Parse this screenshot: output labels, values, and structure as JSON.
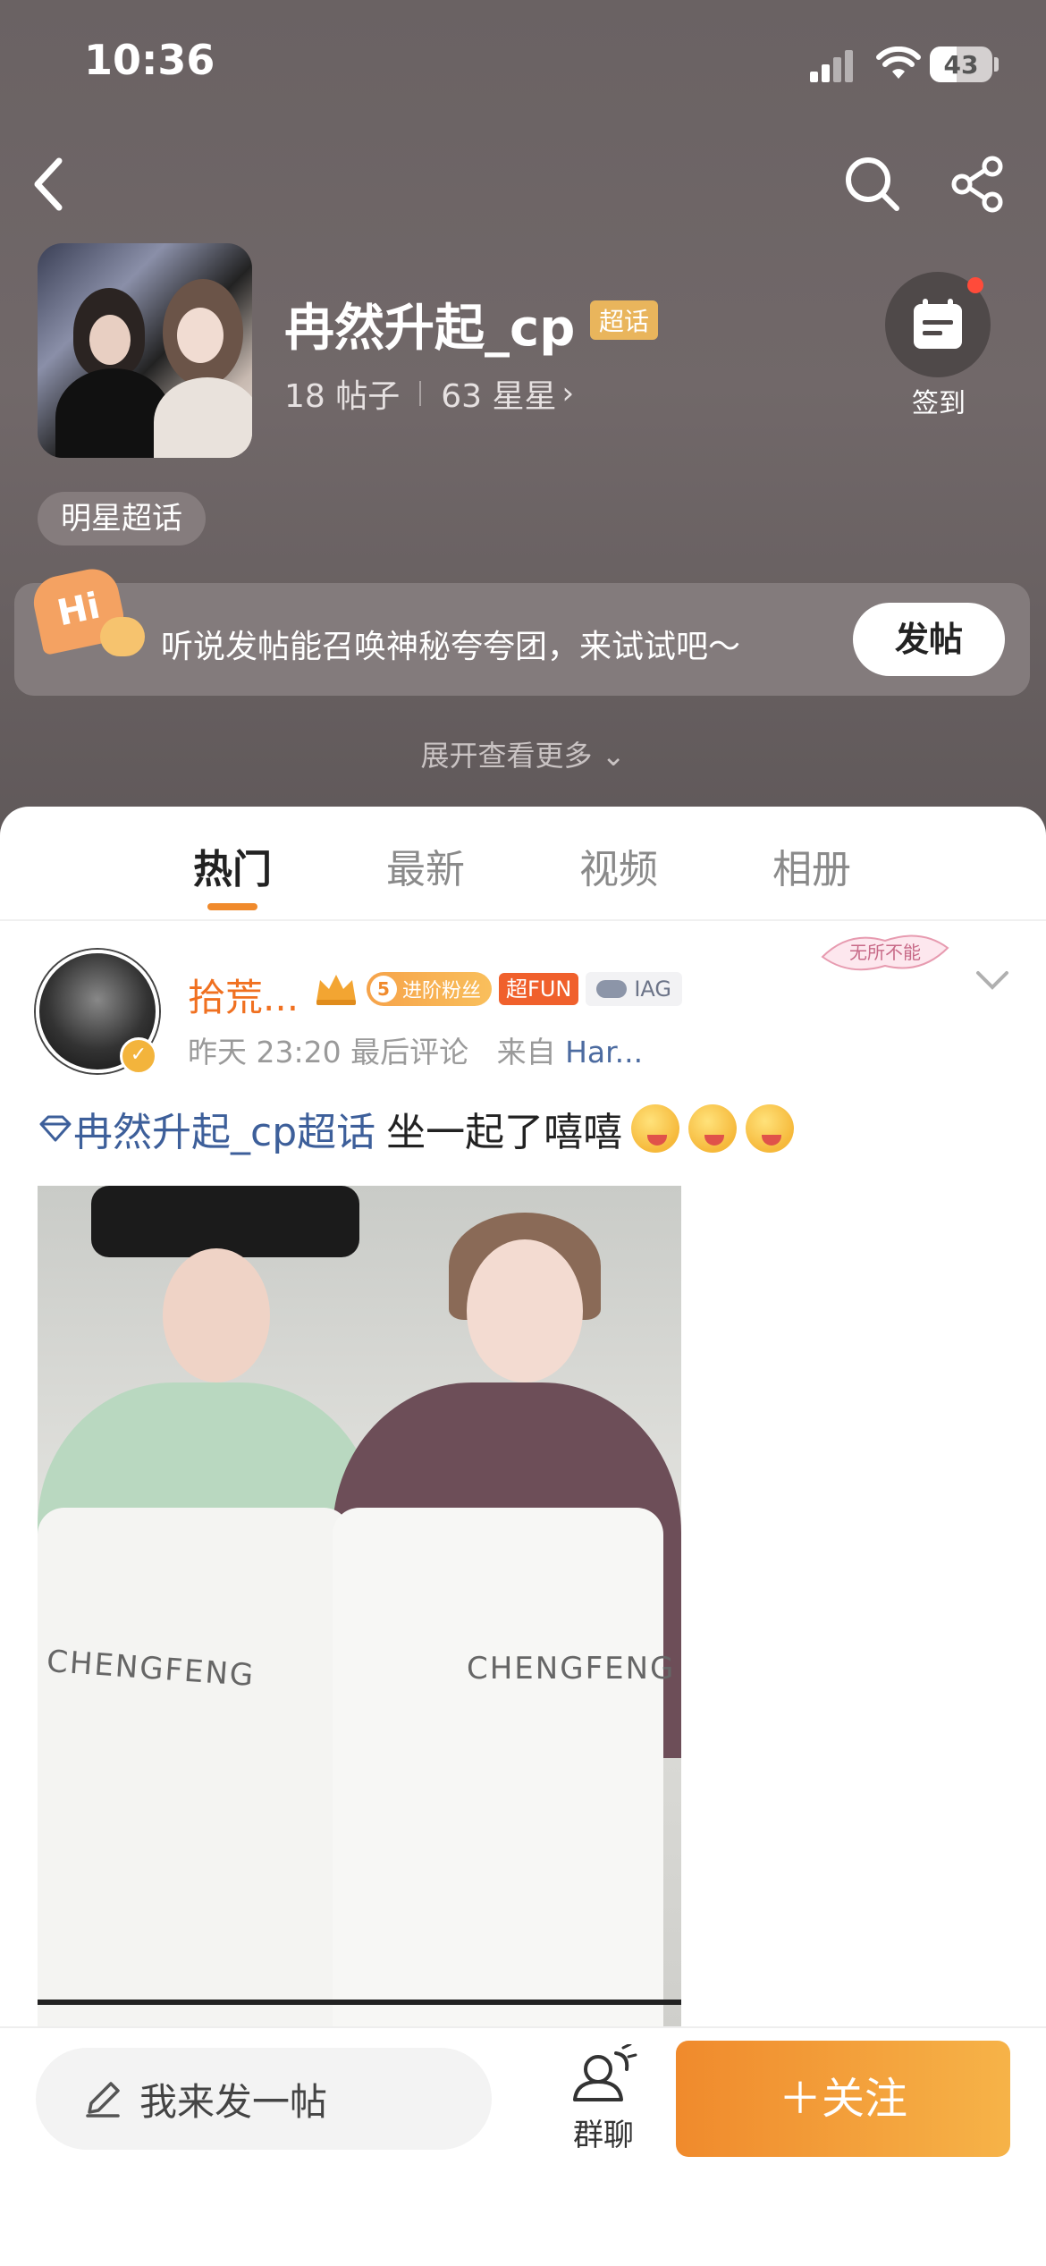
{
  "status_bar": {
    "time": "10:36",
    "battery": "43"
  },
  "nav": {
    "back_icon": "chevron-left-icon",
    "search_icon": "search-icon",
    "share_icon": "share-icon"
  },
  "topic": {
    "name": "冉然升起_cp",
    "badge": "超话",
    "posts": "18 帖子",
    "stars": "63 星星",
    "checkin_label": "签到",
    "category_tag": "明星超话"
  },
  "prompt": {
    "hi": "Hi",
    "text": "听说发帖能召唤神秘夸夸团，来试试吧～",
    "post_button": "发帖"
  },
  "expand_more": "展开查看更多",
  "tabs": [
    {
      "label": "热门",
      "active": true
    },
    {
      "label": "最新",
      "active": false
    },
    {
      "label": "视频",
      "active": false
    },
    {
      "label": "相册",
      "active": false
    }
  ],
  "post": {
    "username": "拾荒...",
    "fan_level": "5",
    "fan_label": "进阶粉丝",
    "fun_badge": "超FUN",
    "iag_badge": "IAG",
    "time": "昨天 23:20 最后评论",
    "source_prefix": "来自",
    "source": "Har...",
    "decor_text": "无所不能",
    "topic_link": "冉然升起_cp超话",
    "content": "坐一起了嘻嘻",
    "emoji_count": 3,
    "image_prints": [
      "CHENGFENG",
      "CHENGFENG"
    ]
  },
  "bottom": {
    "compose_placeholder": "我来发一帖",
    "group_chat": "群聊",
    "follow": "＋关注"
  }
}
